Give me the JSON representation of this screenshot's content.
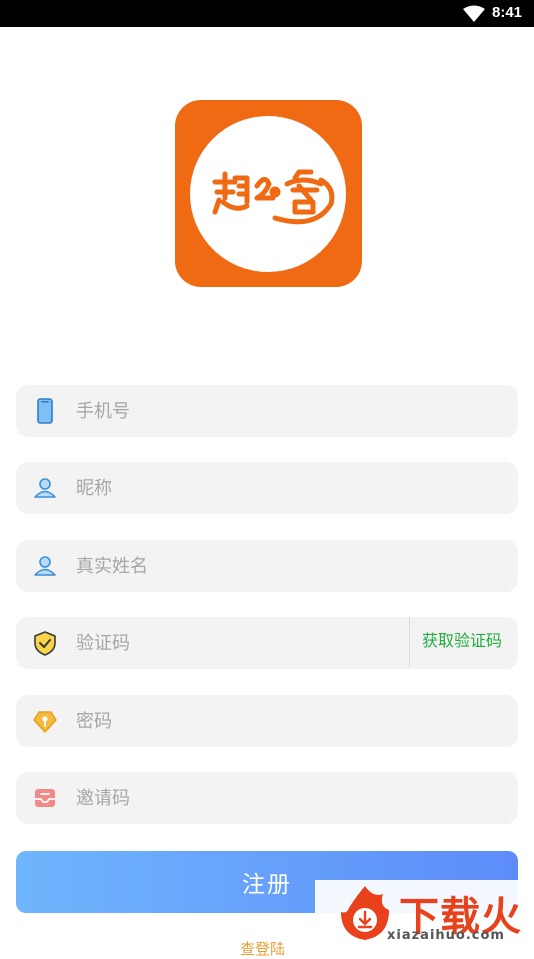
{
  "status_bar": {
    "time": "8:41",
    "icons": [
      "wifi-icon"
    ]
  },
  "logo": {
    "text": "趣Ꮭ客",
    "name": "app-logo"
  },
  "form": {
    "fields": [
      {
        "id": "phone",
        "icon": "phone-icon",
        "placeholder": "手机号",
        "value": ""
      },
      {
        "id": "nickname",
        "icon": "user-icon",
        "placeholder": "昵称",
        "value": ""
      },
      {
        "id": "realname",
        "icon": "user-icon",
        "placeholder": "真实姓名",
        "value": ""
      },
      {
        "id": "code",
        "icon": "shield-check-icon",
        "placeholder": "验证码",
        "value": "",
        "action_label": "获取验证码"
      },
      {
        "id": "password",
        "icon": "key-icon",
        "placeholder": "密码",
        "value": ""
      },
      {
        "id": "invite",
        "icon": "inbox-icon",
        "placeholder": "邀请码",
        "value": ""
      }
    ],
    "submit_label": "注册"
  },
  "footer": {
    "link_text": "查登陆"
  },
  "watermark": {
    "brand": "下载火",
    "url": "xiazaihuo.com"
  },
  "colors": {
    "logo_bg": "#EF6A12",
    "field_bg": "#F3F3F4",
    "action_green": "#1FAE3D",
    "button_start": "#6FB6FD",
    "button_end": "#5D8CF9"
  }
}
